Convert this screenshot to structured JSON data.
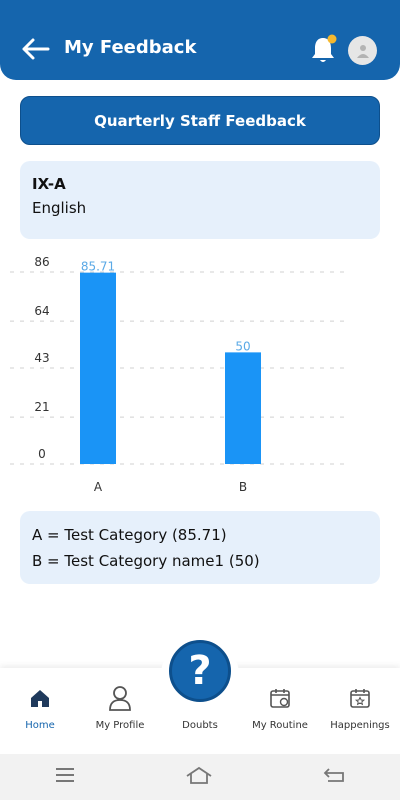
{
  "header": {
    "title": "My Feedback"
  },
  "banner": {
    "label": "Quarterly Staff Feedback"
  },
  "class_info": {
    "class_name": "IX-A",
    "subject": "English"
  },
  "chart_data": {
    "type": "bar",
    "categories": [
      "A",
      "B"
    ],
    "values": [
      85.71,
      50
    ],
    "value_labels": [
      "85.71",
      "50"
    ],
    "yticks": [
      0,
      21,
      43,
      64,
      86
    ],
    "ylim": [
      0,
      86
    ],
    "grid": true,
    "bar_color": "#1a94f6",
    "label_color": "#5aa9e6"
  },
  "legend": {
    "items": [
      "A =  Test Category (85.71)",
      "B =  Test Category name1 (50)"
    ]
  },
  "bottom_nav": {
    "items": [
      {
        "label": "Home",
        "icon": "home-icon",
        "active": true
      },
      {
        "label": "My Profile",
        "icon": "profile-icon",
        "active": false
      },
      {
        "label": "Doubts",
        "icon": "question-icon",
        "active": false
      },
      {
        "label": "My Routine",
        "icon": "calendar-clock-icon",
        "active": false
      },
      {
        "label": "Happenings",
        "icon": "calendar-star-icon",
        "active": false
      }
    ],
    "fab_symbol": "?"
  },
  "colors": {
    "primary": "#1565ad",
    "card_bg": "#e6f0fb",
    "notification_dot": "#f5b82e"
  }
}
